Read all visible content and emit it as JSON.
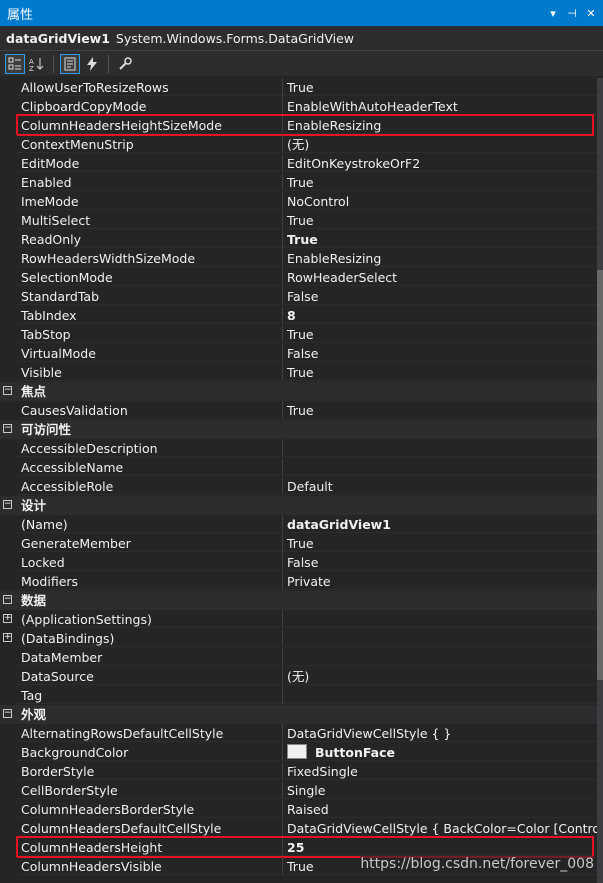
{
  "panel": {
    "title": "属性",
    "dropdown_glyph": "▾",
    "pin_glyph": "⊣",
    "close_glyph": "✕"
  },
  "object": {
    "name": "dataGridView1",
    "type": "System.Windows.Forms.DataGridView"
  },
  "toolbar": {
    "categorized": "categorized-icon",
    "alphabetical": "alphabetical-icon",
    "properties": "properties-icon",
    "events": "events-icon",
    "property_pages": "wrench-icon"
  },
  "rows": [
    {
      "kind": "prop",
      "name": "AllowUserToResizeRows",
      "value": "True"
    },
    {
      "kind": "prop",
      "name": "ClipboardCopyMode",
      "value": "EnableWithAutoHeaderText"
    },
    {
      "kind": "prop",
      "name": "ColumnHeadersHeightSizeMode",
      "value": "EnableResizing",
      "highlight": true
    },
    {
      "kind": "prop",
      "name": "ContextMenuStrip",
      "value": "(无)"
    },
    {
      "kind": "prop",
      "name": "EditMode",
      "value": "EditOnKeystrokeOrF2"
    },
    {
      "kind": "prop",
      "name": "Enabled",
      "value": "True"
    },
    {
      "kind": "prop",
      "name": "ImeMode",
      "value": "NoControl"
    },
    {
      "kind": "prop",
      "name": "MultiSelect",
      "value": "True"
    },
    {
      "kind": "prop",
      "name": "ReadOnly",
      "value": "True",
      "bold": true
    },
    {
      "kind": "prop",
      "name": "RowHeadersWidthSizeMode",
      "value": "EnableResizing"
    },
    {
      "kind": "prop",
      "name": "SelectionMode",
      "value": "RowHeaderSelect"
    },
    {
      "kind": "prop",
      "name": "StandardTab",
      "value": "False"
    },
    {
      "kind": "prop",
      "name": "TabIndex",
      "value": "8",
      "bold": true
    },
    {
      "kind": "prop",
      "name": "TabStop",
      "value": "True"
    },
    {
      "kind": "prop",
      "name": "VirtualMode",
      "value": "False"
    },
    {
      "kind": "prop",
      "name": "Visible",
      "value": "True"
    },
    {
      "kind": "cat",
      "name": "焦点"
    },
    {
      "kind": "prop",
      "name": "CausesValidation",
      "value": "True"
    },
    {
      "kind": "cat",
      "name": "可访问性"
    },
    {
      "kind": "prop",
      "name": "AccessibleDescription",
      "value": ""
    },
    {
      "kind": "prop",
      "name": "AccessibleName",
      "value": ""
    },
    {
      "kind": "prop",
      "name": "AccessibleRole",
      "value": "Default"
    },
    {
      "kind": "cat",
      "name": "设计"
    },
    {
      "kind": "prop",
      "name": "(Name)",
      "value": "dataGridView1",
      "bold": true
    },
    {
      "kind": "prop",
      "name": "GenerateMember",
      "value": "True"
    },
    {
      "kind": "prop",
      "name": "Locked",
      "value": "False"
    },
    {
      "kind": "prop",
      "name": "Modifiers",
      "value": "Private"
    },
    {
      "kind": "cat",
      "name": "数据"
    },
    {
      "kind": "prop",
      "name": "(ApplicationSettings)",
      "value": "",
      "expandable": true
    },
    {
      "kind": "prop",
      "name": "(DataBindings)",
      "value": "",
      "expandable": true
    },
    {
      "kind": "prop",
      "name": "DataMember",
      "value": ""
    },
    {
      "kind": "prop",
      "name": "DataSource",
      "value": "(无)"
    },
    {
      "kind": "prop",
      "name": "Tag",
      "value": ""
    },
    {
      "kind": "cat",
      "name": "外观"
    },
    {
      "kind": "prop",
      "name": "AlternatingRowsDefaultCellStyle",
      "value": "DataGridViewCellStyle { }"
    },
    {
      "kind": "prop",
      "name": "BackgroundColor",
      "value": "ButtonFace",
      "bold": true,
      "swatch": "#f0f0f0"
    },
    {
      "kind": "prop",
      "name": "BorderStyle",
      "value": "FixedSingle"
    },
    {
      "kind": "prop",
      "name": "CellBorderStyle",
      "value": "Single"
    },
    {
      "kind": "prop",
      "name": "ColumnHeadersBorderStyle",
      "value": "Raised"
    },
    {
      "kind": "prop",
      "name": "ColumnHeadersDefaultCellStyle",
      "value": "DataGridViewCellStyle { BackColor=Color [Control], Fo"
    },
    {
      "kind": "prop",
      "name": "ColumnHeadersHeight",
      "value": "25",
      "bold": true,
      "highlight": true
    },
    {
      "kind": "prop",
      "name": "ColumnHeadersVisible",
      "value": "True"
    }
  ],
  "watermark": "https://blog.csdn.net/forever_008",
  "colors": {
    "accent": "#007acc",
    "highlight": "#e81123",
    "background": "#252526"
  }
}
